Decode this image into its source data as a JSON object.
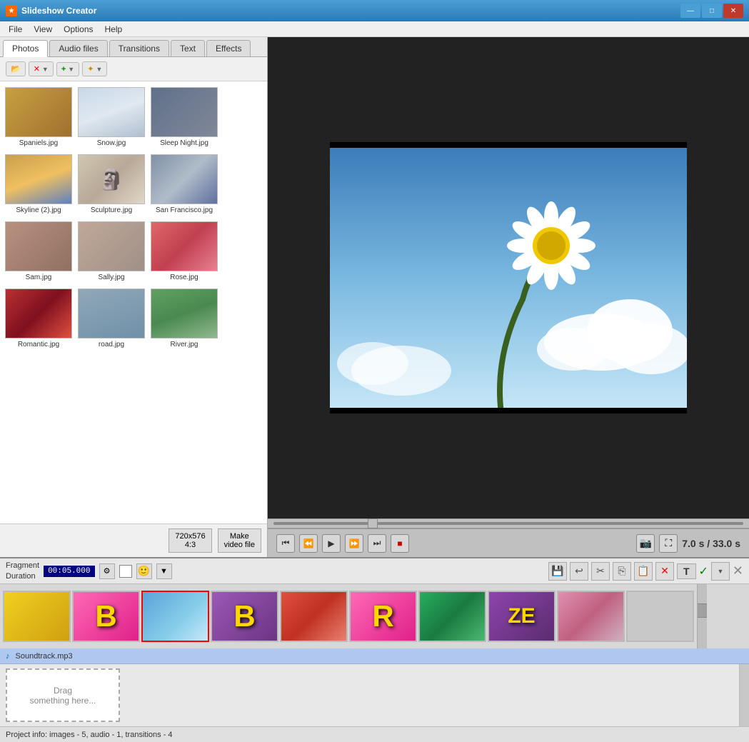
{
  "app": {
    "title": "Slideshow Creator",
    "icon": "★"
  },
  "title_buttons": {
    "minimize": "—",
    "maximize": "□",
    "close": "✕"
  },
  "menu": {
    "items": [
      "File",
      "View",
      "Options",
      "Help"
    ]
  },
  "tabs": {
    "items": [
      "Photos",
      "Audio files",
      "Transitions",
      "Text",
      "Effects"
    ],
    "active": "Photos"
  },
  "toolbar": {
    "open_label": "📂",
    "delete_label": "✕",
    "add_label": "+",
    "auto_label": "✦"
  },
  "files": [
    {
      "name": "Spaniels.jpg",
      "color": "#c8a060"
    },
    {
      "name": "Snow.jpg",
      "color": "#d0e0f0"
    },
    {
      "name": "Sleep Night.jpg",
      "color": "#8090a8"
    },
    {
      "name": "Skyline (2).jpg",
      "color": "#c8a050"
    },
    {
      "name": "Sculpture.jpg",
      "color": "#d0c8b8"
    },
    {
      "name": "San Francisco.jpg",
      "color": "#b0bcc8"
    },
    {
      "name": "Sam.jpg",
      "color": "#b89080"
    },
    {
      "name": "Sally.jpg",
      "color": "#c0a898"
    },
    {
      "name": "Rose.jpg",
      "color": "#e06868"
    },
    {
      "name": "Romantic.jpg",
      "color": "#b83030"
    },
    {
      "name": "road.jpg",
      "color": "#90a8b8"
    },
    {
      "name": "River.jpg",
      "color": "#60a060"
    }
  ],
  "resolution": {
    "label": "720x576\n4:3",
    "button_label": "Make\nvideo file"
  },
  "preview": {
    "time_current": "7.0 s",
    "time_total": "33.0 s",
    "separator": "/"
  },
  "playback": {
    "rewind_start": "⏮",
    "rewind": "⏪",
    "play": "▶",
    "forward": "⏩",
    "forward_end": "⏭",
    "stop": "■",
    "camera": "📷",
    "fullscreen": "⛶"
  },
  "fragment": {
    "label": "Fragment\nDuration",
    "time": "00:05.000",
    "check_icon": "✓",
    "settings_icon": "⚙"
  },
  "fragment_toolbar": {
    "save": "💾",
    "undo": "↩",
    "cut": "✂",
    "copy": "📋",
    "paste": "📋",
    "delete": "✕",
    "text_btn": "T",
    "check_btn": "✓",
    "x_btn": "✕"
  },
  "timeline": {
    "items": [
      {
        "type": "photo",
        "bg": "#f0c020",
        "label": ""
      },
      {
        "type": "text",
        "bg": "#ff69b4",
        "letter": "B"
      },
      {
        "type": "photo-sky",
        "bg": "#87ceeb",
        "selected": true,
        "label": ""
      },
      {
        "type": "text",
        "bg": "#9b59b6",
        "letter": "B"
      },
      {
        "type": "photo-rose",
        "bg": "#e8503a",
        "label": ""
      },
      {
        "type": "text",
        "bg": "#ff69b4",
        "letter": "R"
      },
      {
        "type": "photo-green",
        "bg": "#2ecc71",
        "label": ""
      },
      {
        "type": "text",
        "bg": "#8e44ad",
        "letter": "ZE"
      },
      {
        "type": "photo-flower",
        "bg": "#e0a0b0",
        "label": ""
      },
      {
        "type": "empty",
        "bg": "#d0d0d0",
        "label": ""
      }
    ]
  },
  "audio_track": {
    "icon": "♪",
    "filename": "Soundtrack.mp3"
  },
  "drop_zone": {
    "text": "Drag\nsomething here..."
  },
  "status_bar": {
    "text": "Project info: images - 5, audio - 1, transitions - 4"
  }
}
